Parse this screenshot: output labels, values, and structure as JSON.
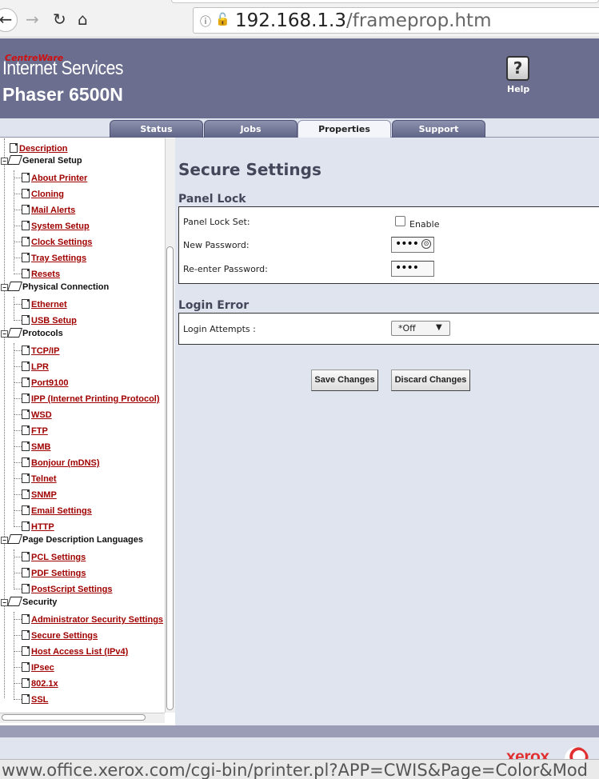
{
  "browser": {
    "url_host": "192.168.1.3",
    "url_path": "/frameprop.htm",
    "status_url": "www.office.xerox.com/cgi-bin/printer.pl?APP=CWIS&Page=Color&Mod"
  },
  "header": {
    "brand_small": "CentreWare",
    "brand_main": "Internet Services",
    "model": "Phaser 6500N",
    "help_label": "Help"
  },
  "tabs": [
    {
      "label": "Status",
      "active": false
    },
    {
      "label": "Jobs",
      "active": false
    },
    {
      "label": "Properties",
      "active": true
    },
    {
      "label": "Support",
      "active": false
    }
  ],
  "tree": {
    "description": "Description",
    "general_setup": {
      "label": "General Setup",
      "items": [
        "About Printer",
        "Cloning",
        "Mail Alerts",
        "System Setup",
        "Clock Settings",
        "Tray Settings",
        "Resets"
      ]
    },
    "physical_connection": {
      "label": "Physical Connection",
      "items": [
        "Ethernet",
        "USB Setup"
      ]
    },
    "protocols": {
      "label": "Protocols",
      "items": [
        "TCP/IP",
        "LPR",
        "Port9100",
        "IPP (Internet Printing Protocol)",
        "WSD",
        "FTP",
        "SMB",
        "Bonjour (mDNS)",
        "Telnet",
        "SNMP",
        "Email Settings",
        "HTTP"
      ]
    },
    "pdl": {
      "label": "Page Description Languages",
      "items": [
        "PCL Settings",
        "PDF Settings",
        "PostScript Settings"
      ]
    },
    "security": {
      "label": "Security",
      "items": [
        "Administrator Security Settings",
        "Secure Settings",
        "Host Access List (IPv4)",
        "IPsec",
        "802.1x",
        "SSL"
      ]
    }
  },
  "main": {
    "title": "Secure Settings",
    "panel_lock": {
      "heading": "Panel Lock",
      "lock_label": "Panel Lock Set:",
      "enable_label": "Enable",
      "enabled": false,
      "new_password_label": "New Password:",
      "new_password_value": "••••",
      "reenter_label": "Re-enter Password:",
      "reenter_value": "••••"
    },
    "login_error": {
      "heading": "Login Error",
      "attempts_label": "Login Attempts :",
      "attempts_value": "*Off"
    },
    "save_label": "Save Changes",
    "discard_label": "Discard Changes"
  },
  "footer": {
    "logo_text": "xerox"
  }
}
